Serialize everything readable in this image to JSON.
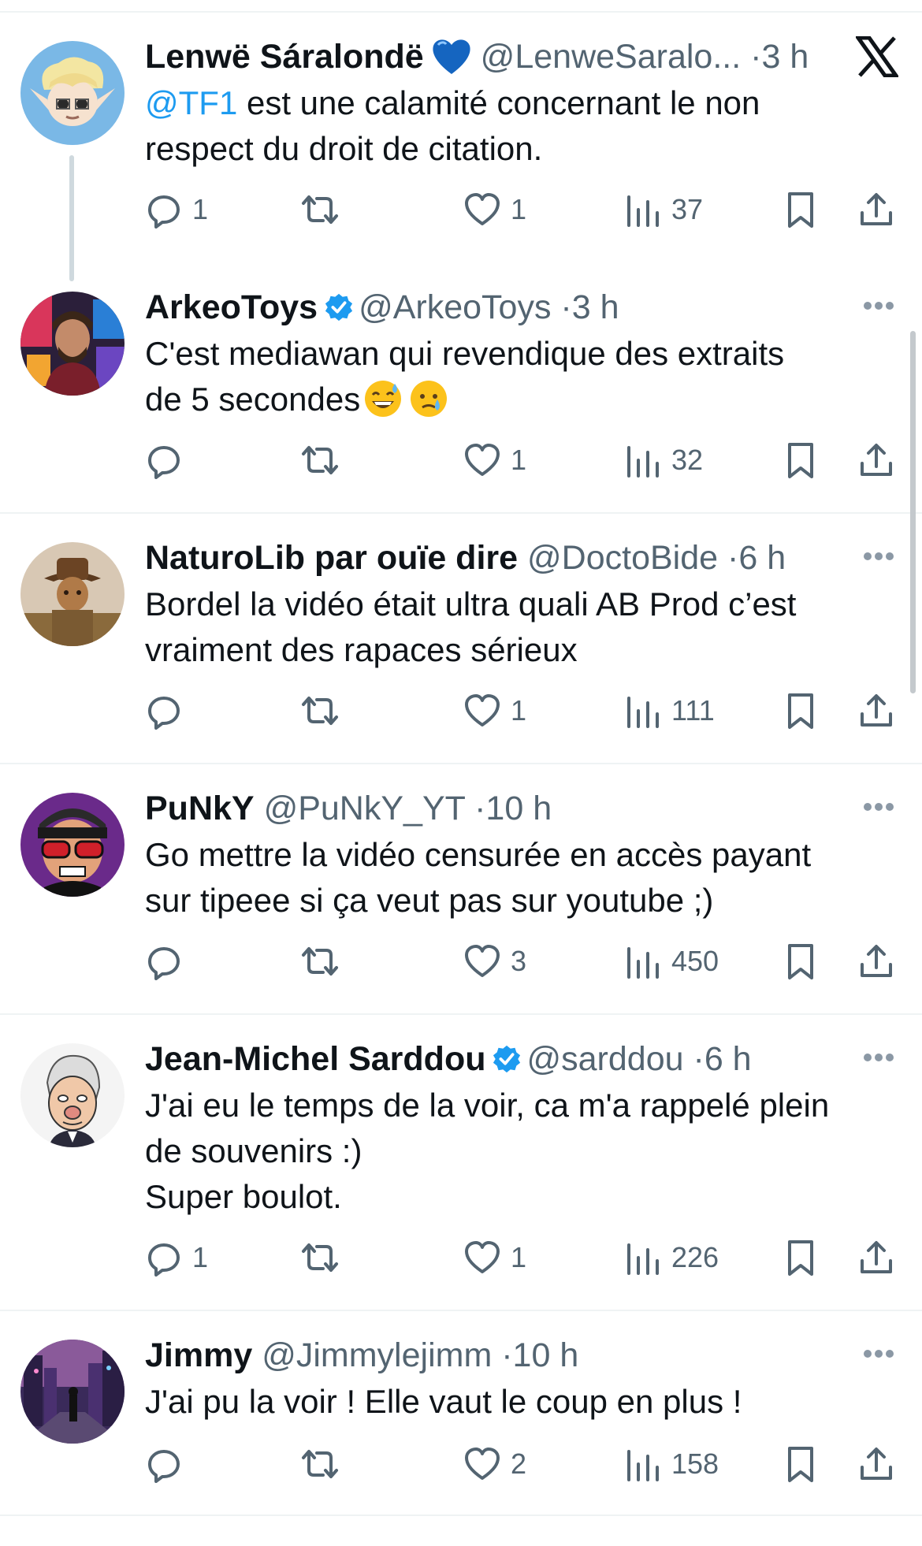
{
  "tweets": [
    {
      "name": "Lenwë Sáralondë",
      "name_emoji": "blue-heart",
      "verified": false,
      "handle": "@LenweSaralo...",
      "time": "3 h",
      "text_mention": "@TF1",
      "text": " est une calamité concernant le non\nrespect du droit de citation.",
      "replies": "1",
      "retweets": "",
      "likes": "1",
      "views": "37",
      "avatar": "elf-cartoon-avatar"
    },
    {
      "name": "ArkeoToys",
      "verified": true,
      "handle": "@ArkeoToys",
      "time": "3 h",
      "text": "C'est mediawan qui revendique des extraits\nde 5 secondes",
      "text_emojis": [
        "grinning-sweat-emoji",
        "tearful-face-emoji"
      ],
      "replies": "",
      "retweets": "",
      "likes": "1",
      "views": "32",
      "avatar": "neon-room-photo-avatar"
    },
    {
      "name": "NaturoLib par ouïe dire",
      "verified": false,
      "handle": "@DoctoBide",
      "time": "6 h",
      "text": "Bordel la vidéo était ultra quali AB Prod c’est\nvraiment des rapaces sérieux",
      "replies": "",
      "retweets": "",
      "likes": "1",
      "views": "111",
      "avatar": "scarecrow-photo-avatar"
    },
    {
      "name": "PuNkY",
      "verified": false,
      "handle": "@PuNkY_YT",
      "time": "10 h",
      "text": "Go mettre la vidéo censurée en accès payant\nsur tipeee si ça veut pas sur youtube ;)",
      "replies": "",
      "retweets": "",
      "likes": "3",
      "views": "450",
      "avatar": "sunglasses-cartoon-avatar"
    },
    {
      "name": "Jean-Michel Sarddou",
      "verified": true,
      "handle": "@sarddou",
      "time": "6 h",
      "text": "J'ai eu le temps de la voir, ca m'a rappelé plein\nde souvenirs :)\nSuper boulot.",
      "replies": "1",
      "retweets": "",
      "likes": "1",
      "views": "226",
      "avatar": "caricature-avatar"
    },
    {
      "name": "Jimmy",
      "verified": false,
      "handle": "@Jimmylejimm",
      "time": "10 h",
      "text": "J'ai pu la voir ! Elle vaut le coup en plus !",
      "replies": "",
      "retweets": "",
      "likes": "2",
      "views": "158",
      "avatar": "street-night-avatar"
    }
  ],
  "separator": "·",
  "colors": {
    "mention": "#1d9bf0",
    "verified": "#1d9bf0",
    "secondary_text": "#536471",
    "divider": "#eff3f4"
  }
}
